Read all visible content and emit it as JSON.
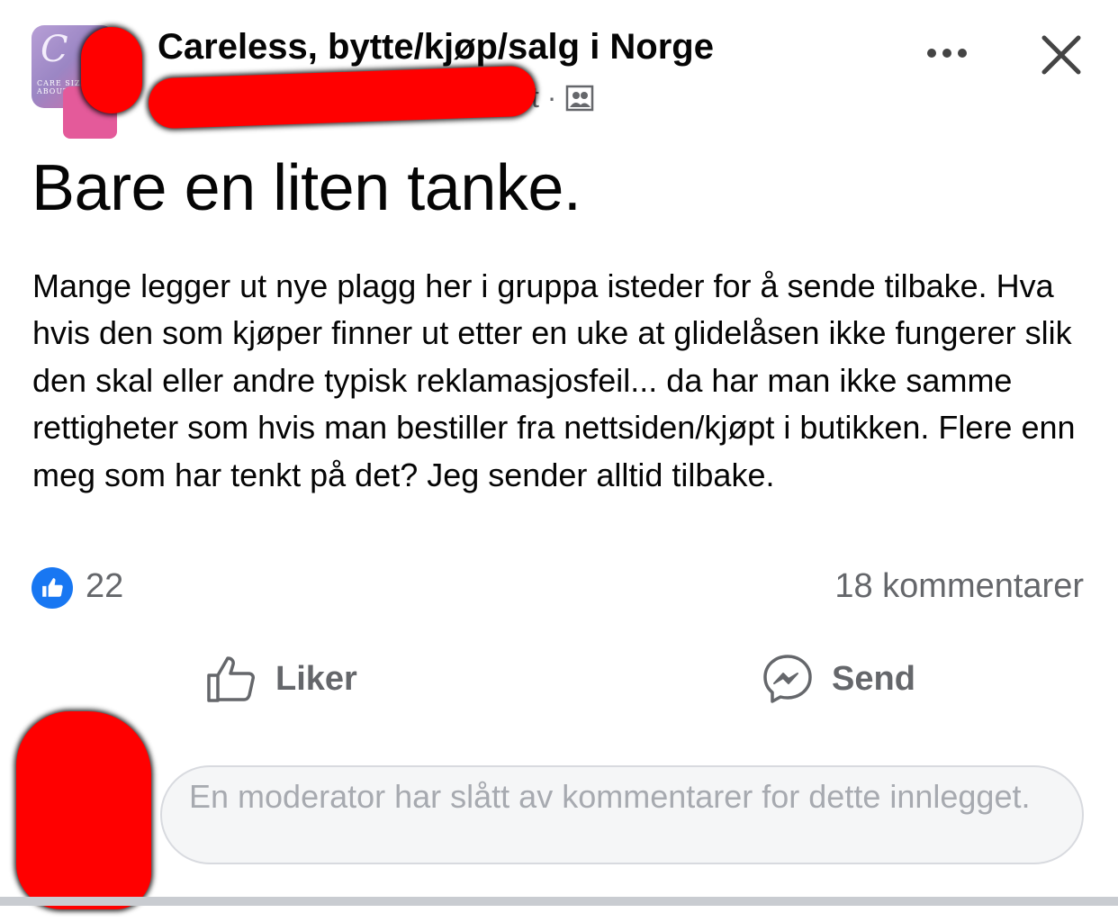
{
  "header": {
    "group_name": "Careless, bytte/kjøp/salg i Norge",
    "avatar_letter": "C",
    "avatar_text": "CARE SIZE ABOUT",
    "meta_visible": "t ·",
    "privacy_icon": "members-group-icon"
  },
  "post": {
    "title": "Bare en liten tanke.",
    "body": "Mange legger ut nye plagg her i gruppa isteder for å sende tilbake. Hva hvis den som kjøper finner ut etter en uke at glidelåsen ikke fungerer slik den skal eller andre typisk reklamasjosfeil... da har man ikke samme rettigheter som hvis man bestiller fra nettsiden/kjøpt i butikken. Flere enn meg som har tenkt på det? Jeg sender alltid tilbake."
  },
  "reactions": {
    "like_count": "22",
    "comments_label": "18 kommentarer"
  },
  "actions": {
    "like_label": "Liker",
    "send_label": "Send"
  },
  "comment_box": {
    "disabled_message": "En moderator har slått av kommentarer for dette innlegget."
  },
  "colors": {
    "accent": "#1877f2",
    "secondary_text": "#65676b",
    "redaction": "#ff0000"
  }
}
